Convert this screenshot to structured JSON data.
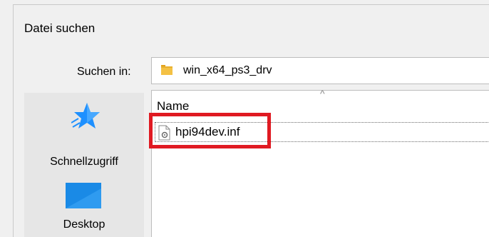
{
  "dialog": {
    "title": "Datei suchen"
  },
  "lookin": {
    "label": "Suchen in:",
    "value": "win_x64_ps3_drv",
    "icon": "folder-icon"
  },
  "places": [
    {
      "label": "Schnellzugriff",
      "icon": "quick-access-star-icon"
    },
    {
      "label": "Desktop",
      "icon": "desktop-icon"
    }
  ],
  "filelist": {
    "column_name": "Name",
    "sort_indicator": "^",
    "files": [
      {
        "name": "hpi94dev.inf",
        "icon": "inf-file-icon"
      }
    ]
  },
  "colors": {
    "highlight": "#e01a22",
    "star": "#1e90ff",
    "desktop": "#1a8ae6",
    "folder": "#f4c144"
  }
}
